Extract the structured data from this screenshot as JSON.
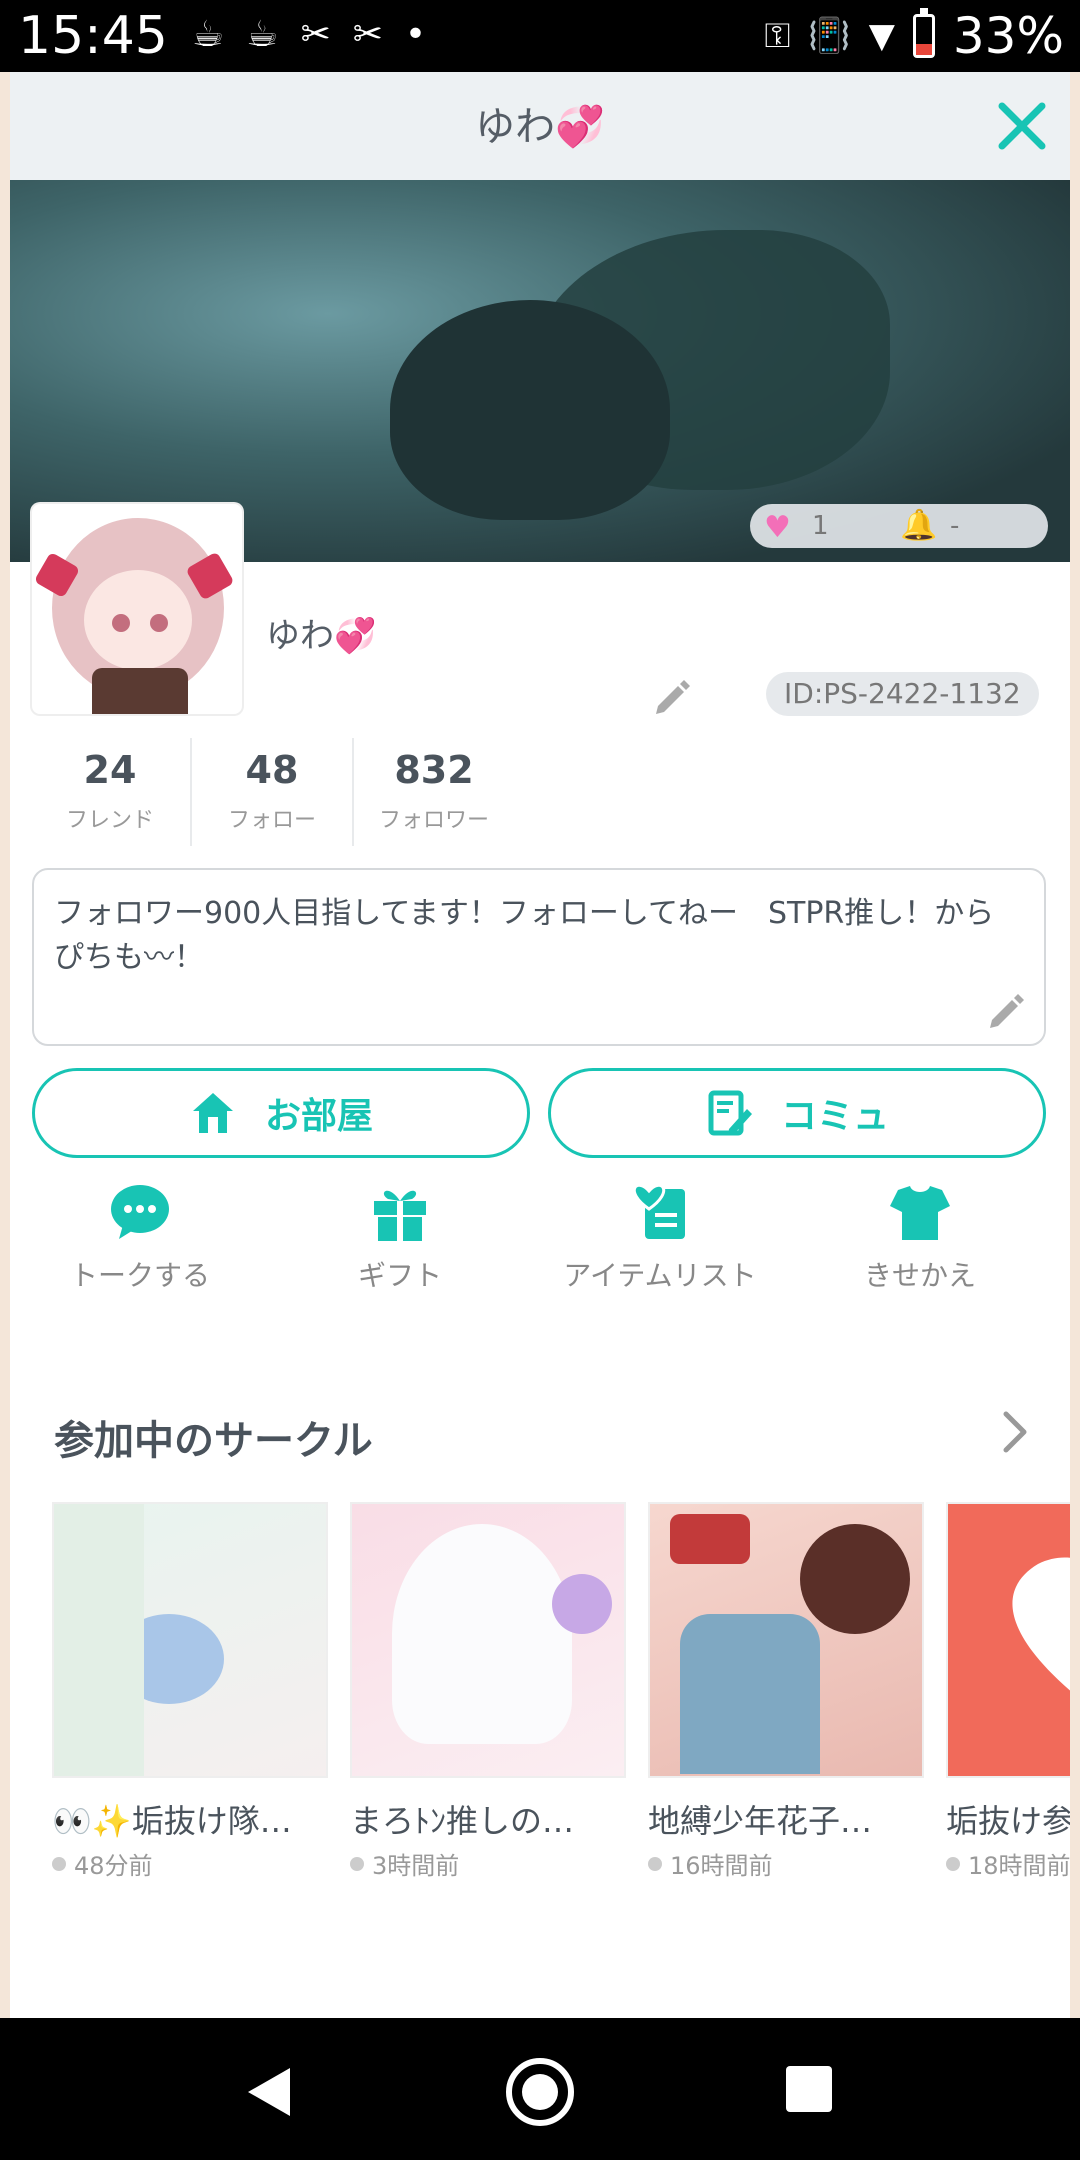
{
  "status_bar": {
    "time": "15:45",
    "battery_percent": "33%",
    "battery_level": 0.33,
    "left_icons": [
      "cup-icon",
      "cup-icon",
      "capcut-icon",
      "capcut-icon",
      "dot-icon"
    ],
    "right_icons": [
      "key-icon",
      "vibrate-icon",
      "signal-icon",
      "battery-icon"
    ]
  },
  "header": {
    "title": "ゆわ💞",
    "close_icon": "close-icon"
  },
  "banner": {
    "likes_count": "1",
    "notifications": "-"
  },
  "profile": {
    "name": "ゆわ💞",
    "id_label": "ID:PS-2422-1132"
  },
  "stats": [
    {
      "value": "24",
      "label": "フレンド"
    },
    {
      "value": "48",
      "label": "フォロー"
    },
    {
      "value": "832",
      "label": "フォロワー"
    }
  ],
  "bio": {
    "text": "フォロワー900人目指してます！フォローしてねー　STPR推し！からぴちも〰！"
  },
  "buttons": {
    "room_label": "お部屋",
    "community_label": "コミュ"
  },
  "actions": [
    {
      "label": "トークする",
      "icon": "chat-icon"
    },
    {
      "label": "ギフト",
      "icon": "gift-icon"
    },
    {
      "label": "アイテムリスト",
      "icon": "item-list-icon"
    },
    {
      "label": "きせかえ",
      "icon": "tshirt-icon"
    }
  ],
  "circles_section": {
    "title": "参加中のサークル",
    "items": [
      {
        "title": "👀✨垢抜け隊…",
        "time": "48分前"
      },
      {
        "title": "まろﾄﾝ推しの…",
        "time": "3時間前"
      },
      {
        "title": "地縛少年花子…",
        "time": "16時間前"
      },
      {
        "title": "垢抜け参",
        "time": "18時間前"
      }
    ]
  },
  "colors": {
    "accent": "#18c4b4",
    "text": "#4a535c",
    "muted": "#999999",
    "heart": "#f36fb8",
    "bell": "#f2b400"
  }
}
